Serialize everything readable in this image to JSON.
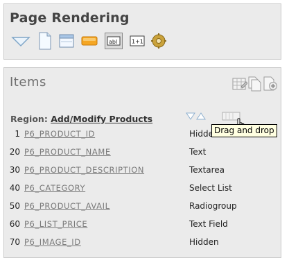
{
  "page_rendering": {
    "title": "Page Rendering",
    "toolbar_icons": [
      "triangle-down-icon",
      "page-icon",
      "window-icon",
      "orange-button-icon",
      "text-field-icon",
      "numeric-field-icon",
      "gear-icon"
    ]
  },
  "items": {
    "title": "Items",
    "region_label": "Region:",
    "region_name": "Add/Modify Products",
    "header_icons": [
      "grid-edit-icon",
      "copy-icon",
      "add-icon"
    ],
    "rows": [
      {
        "seq": "1",
        "name": "P6_PRODUCT_ID",
        "type": "Hidden"
      },
      {
        "seq": "20",
        "name": "P6_PRODUCT_NAME",
        "type": "Text"
      },
      {
        "seq": "30",
        "name": "P6_PRODUCT_DESCRIPTION",
        "type": "Textarea"
      },
      {
        "seq": "40",
        "name": "P6_CATEGORY",
        "type": "Select List"
      },
      {
        "seq": "50",
        "name": "P6_PRODUCT_AVAIL",
        "type": "Radiogroup"
      },
      {
        "seq": "60",
        "name": "P6_LIST_PRICE",
        "type": "Text Field"
      },
      {
        "seq": "70",
        "name": "P6_IMAGE_ID",
        "type": "Hidden"
      }
    ]
  },
  "tooltip": "Drag and drop"
}
